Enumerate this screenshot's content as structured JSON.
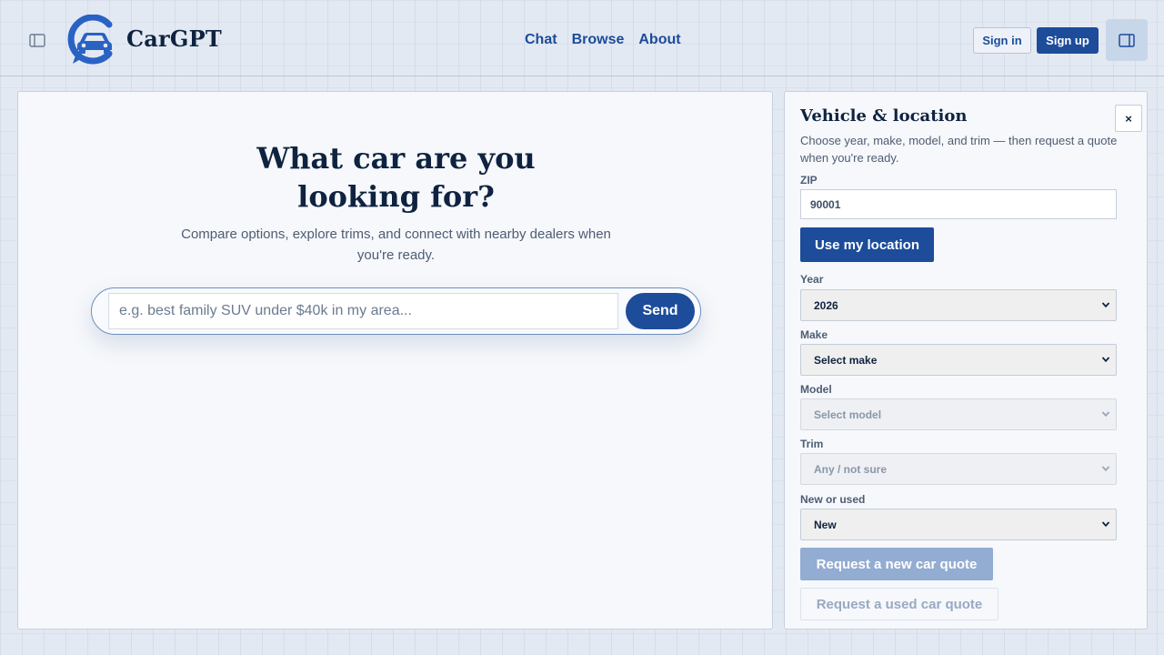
{
  "header": {
    "brand": "CarGPT",
    "nav": [
      {
        "label": "Chat"
      },
      {
        "label": "Browse"
      },
      {
        "label": "About"
      }
    ],
    "sign_in": "Sign in",
    "sign_up": "Sign up"
  },
  "main": {
    "title": "What car are you looking for?",
    "subtitle": "Compare options, explore trims, and connect with nearby dealers when you're ready.",
    "search_placeholder": "e.g. best family SUV under $40k in my area...",
    "send_label": "Send"
  },
  "panel": {
    "title": "Vehicle & location",
    "description": "Choose year, make, model, and trim — then request a quote when you're ready.",
    "close_label": "×",
    "zip_label": "ZIP",
    "zip_value": "90001",
    "use_location": "Use my location",
    "year_label": "Year",
    "year_value": "2026",
    "make_label": "Make",
    "make_value": "Select make",
    "model_label": "Model",
    "model_value": "Select model",
    "trim_label": "Trim",
    "trim_value": "Any / not sure",
    "condition_label": "New or used",
    "condition_value": "New",
    "quote_new": "Request a new car quote",
    "quote_used": "Request a used car quote"
  },
  "colors": {
    "primary": "#1c4c9a",
    "primary_disabled": "#93acd2",
    "text": "#0f2340",
    "muted": "#4d5d74"
  }
}
